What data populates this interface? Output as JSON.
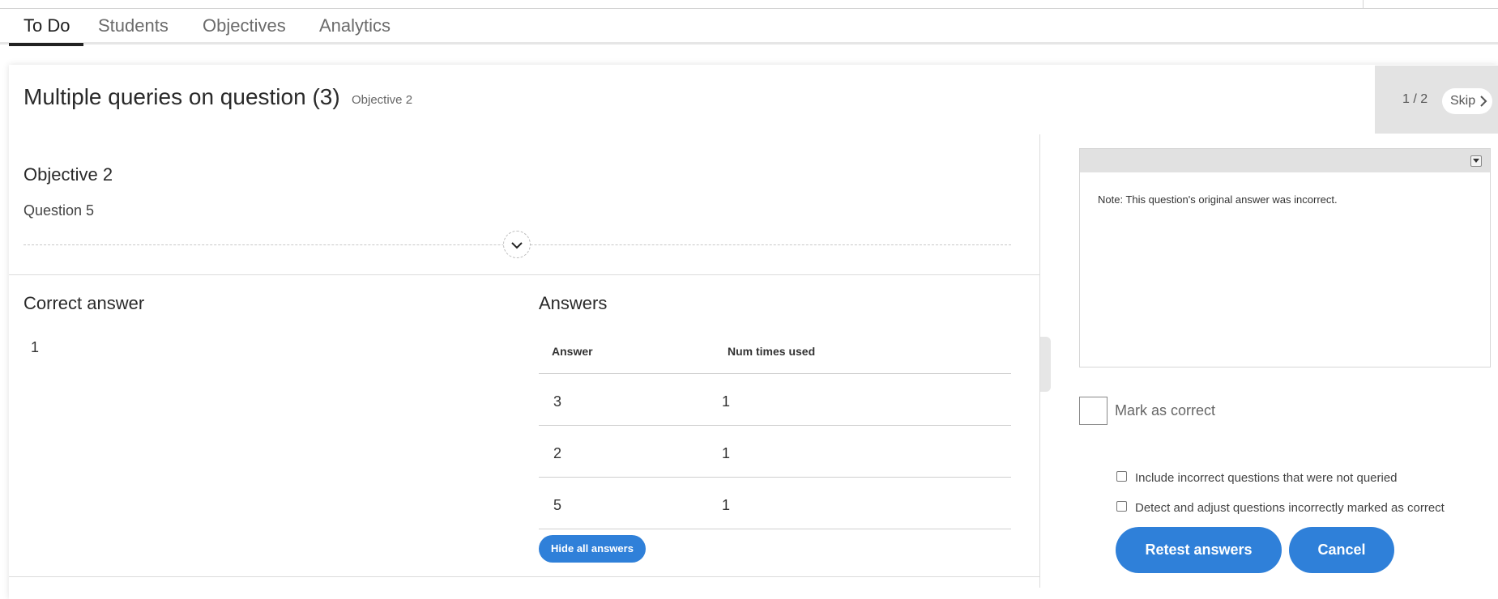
{
  "tabs": [
    {
      "label": "To Do"
    },
    {
      "label": "Students"
    },
    {
      "label": "Objectives"
    },
    {
      "label": "Analytics"
    }
  ],
  "header": {
    "title": "Multiple queries on question (3)",
    "subtitle": "Objective 2",
    "pager": "1 / 2",
    "skip_label": "Skip"
  },
  "objective": {
    "title": "Objective 2",
    "question": "Question 5"
  },
  "correct_answer": {
    "heading": "Correct answer",
    "value": "1"
  },
  "answers": {
    "heading": "Answers",
    "columns": [
      "Answer",
      "Num times used"
    ],
    "rows": [
      {
        "answer": "3",
        "count": "1"
      },
      {
        "answer": "2",
        "count": "1"
      },
      {
        "answer": "5",
        "count": "1"
      }
    ],
    "hide_button": "Hide all answers"
  },
  "note": {
    "text": "Note: This question's original answer was incorrect."
  },
  "mark_correct": {
    "label": "Mark as correct",
    "checked": false
  },
  "options": [
    {
      "label": "Include incorrect questions that were not queried",
      "checked": false
    },
    {
      "label": "Detect and adjust questions incorrectly marked as correct",
      "checked": false
    }
  ],
  "actions": {
    "retest": "Retest answers",
    "cancel": "Cancel"
  },
  "colors": {
    "accent": "#2f80d9"
  }
}
